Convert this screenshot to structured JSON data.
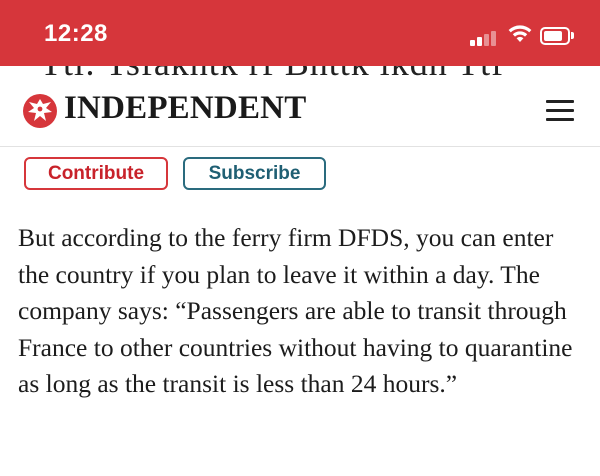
{
  "status_bar": {
    "time": "12:28",
    "background": "#d6363b"
  },
  "header_peek": {
    "text": "Ttl: Tsfakhtk rf Bhttk lkdh Ttf"
  },
  "masthead": {
    "logo_text": "INDEPENDENT",
    "logo_icon": "eagle-icon",
    "menu_icon": "hamburger-menu-icon"
  },
  "cta": {
    "contribute_label": "Contribute",
    "subscribe_label": "Subscribe",
    "contribute_color": "#d6363b",
    "subscribe_color": "#2a6b7e"
  },
  "article": {
    "paragraph": "But according to the ferry firm DFDS, you can enter the country if you plan to leave it within a day. The company says: “Passengers are able to transit through France to other countries without having to quarantine as long as the transit is less than 24 hours.”"
  }
}
